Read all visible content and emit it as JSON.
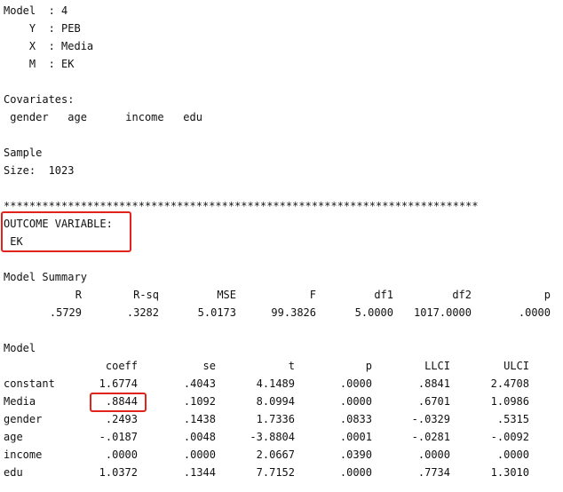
{
  "model_info": {
    "model_line": "Model  : 4",
    "y_line": "    Y  : PEB",
    "x_line": "    X  : Media",
    "m_line": "    M  : EK"
  },
  "covariates": {
    "title": "Covariates:",
    "list": " gender   age      income   edu"
  },
  "sample": {
    "title": "Sample",
    "size_line": "Size:  1023"
  },
  "separator": "**************************************************************************",
  "outcome": {
    "title": "OUTCOME VARIABLE:",
    "value": " EK"
  },
  "model_summary": {
    "title": "Model Summary",
    "headers": [
      "R",
      "R-sq",
      "MSE",
      "F",
      "df1",
      "df2",
      "p"
    ],
    "values": [
      ".5729",
      ".3282",
      "5.0173",
      "99.3826",
      "5.0000",
      "1017.0000",
      ".0000"
    ]
  },
  "model_table": {
    "title": "Model",
    "headers": [
      "coeff",
      "se",
      "t",
      "p",
      "LLCI",
      "ULCI"
    ],
    "rows": [
      {
        "name": "constant",
        "cells": [
          "1.6774",
          ".4043",
          "4.1489",
          ".0000",
          ".8841",
          "2.4708"
        ]
      },
      {
        "name": "Media",
        "cells": [
          ".8844",
          ".1092",
          "8.0994",
          ".0000",
          ".6701",
          "1.0986"
        ]
      },
      {
        "name": "gender",
        "cells": [
          ".2493",
          ".1438",
          "1.7336",
          ".0833",
          "-.0329",
          ".5315"
        ]
      },
      {
        "name": "age",
        "cells": [
          "-.0187",
          ".0048",
          "-3.8804",
          ".0001",
          "-.0281",
          "-.0092"
        ]
      },
      {
        "name": "income",
        "cells": [
          ".0000",
          ".0000",
          "2.0667",
          ".0390",
          ".0000",
          ".0000"
        ]
      },
      {
        "name": "edu",
        "cells": [
          "1.0372",
          ".1344",
          "7.7152",
          ".0000",
          ".7734",
          "1.3010"
        ]
      }
    ]
  },
  "highlight_color": "#e0241b"
}
